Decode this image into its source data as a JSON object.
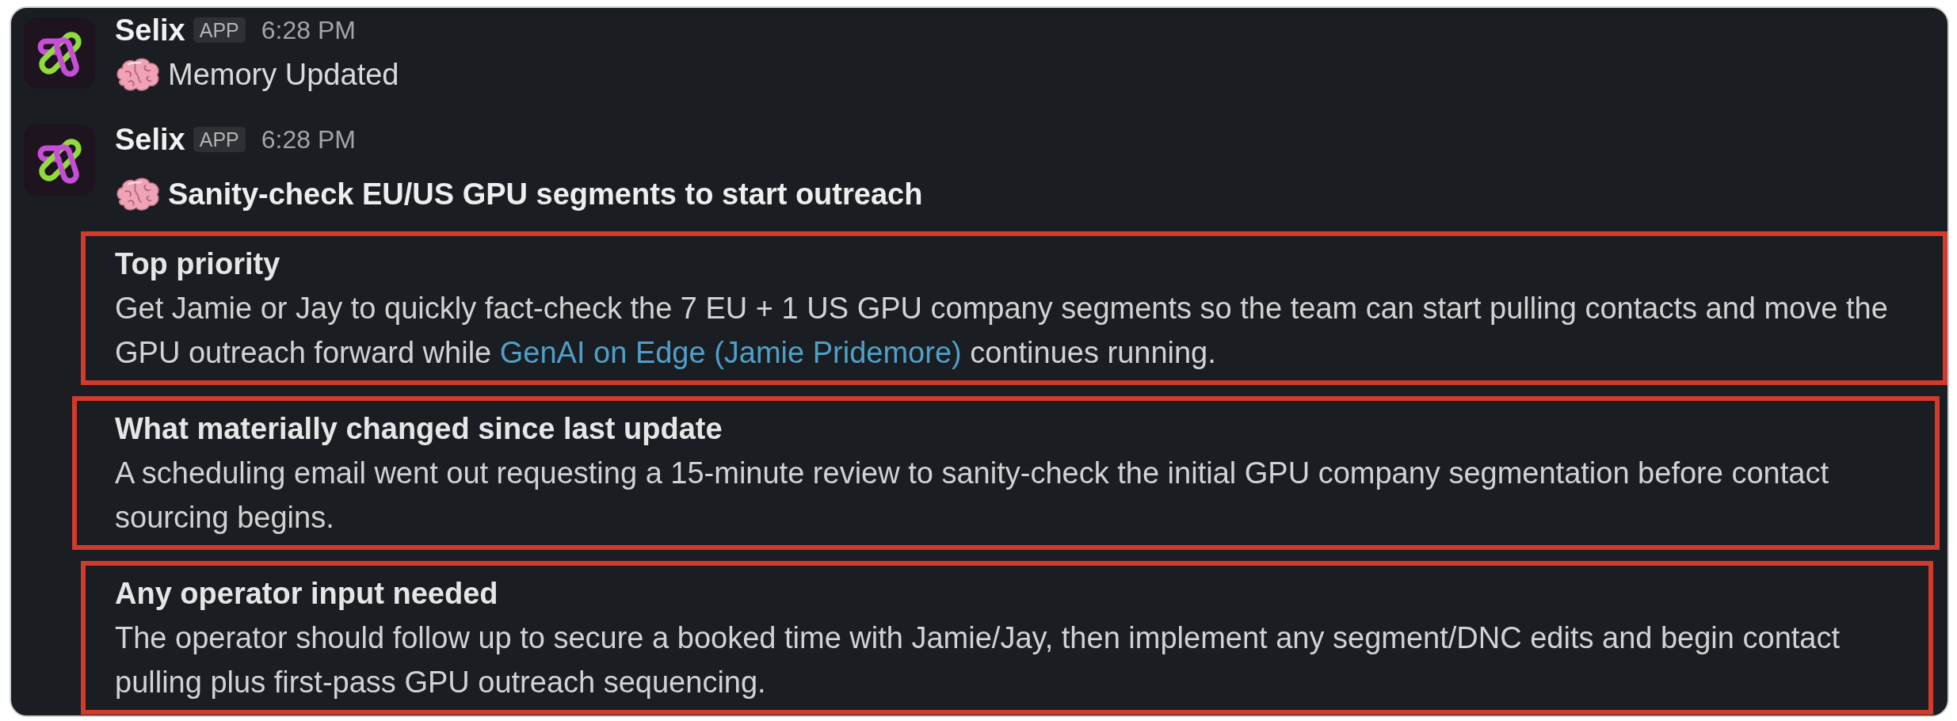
{
  "messages": [
    {
      "sender": "Selix",
      "badge": "APP",
      "time": "6:28 PM",
      "kind": "status",
      "text": "Memory Updated"
    },
    {
      "sender": "Selix",
      "badge": "APP",
      "time": "6:28 PM",
      "kind": "title",
      "text": "Sanity-check EU/US GPU segments to start outreach",
      "sections": [
        {
          "heading": "Top priority",
          "highlighted": true,
          "body": [
            {
              "kind": "text",
              "text": "Get Jamie or Jay to quickly fact-check the 7 EU + 1 US GPU company segments so the team can start pulling contacts and move the GPU outreach forward while "
            },
            {
              "kind": "link",
              "text": "GenAI on Edge (Jamie Pridemore)"
            },
            {
              "kind": "text",
              "text": " continues running."
            }
          ]
        },
        {
          "heading": "What materially changed since last update",
          "highlighted": true,
          "body": [
            {
              "kind": "text",
              "text": "A scheduling email went out requesting a 15-minute review to sanity-check the initial GPU company segmentation before contact sourcing begins."
            }
          ]
        },
        {
          "heading": "Any operator input needed",
          "highlighted": true,
          "body": [
            {
              "kind": "text",
              "text": "The operator should follow up to secure a booked time with Jamie/Jay, then implement any segment/DNC edits and begin contact pulling plus first-pass GPU outreach sequencing."
            }
          ]
        }
      ]
    }
  ]
}
